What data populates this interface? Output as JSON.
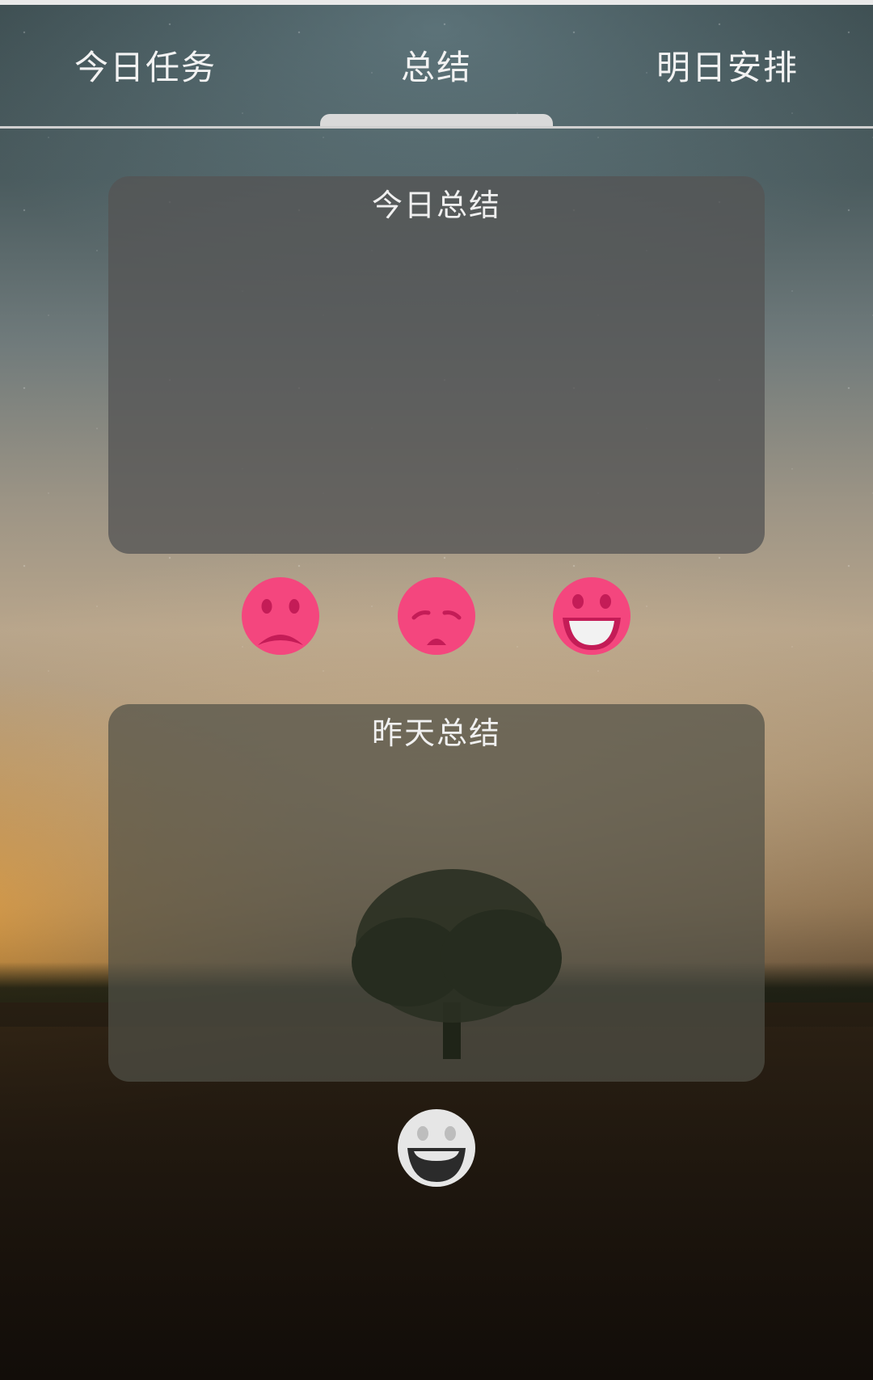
{
  "tabs": [
    {
      "label": "今日任务"
    },
    {
      "label": "总结"
    },
    {
      "label": "明日安排"
    }
  ],
  "active_tab": 1,
  "today_summary": {
    "title": "今日总结",
    "content": ""
  },
  "moods": [
    {
      "icon": "sad-face-icon"
    },
    {
      "icon": "tired-face-icon"
    },
    {
      "icon": "happy-face-icon"
    }
  ],
  "yesterday_summary": {
    "title": "昨天总结",
    "content": ""
  },
  "yesterday_mood": {
    "icon": "happy-face-icon"
  },
  "colors": {
    "mood_pink": "#f4467e",
    "mood_dark": "#c41c57",
    "neutral_face": "#e6e6e6"
  }
}
